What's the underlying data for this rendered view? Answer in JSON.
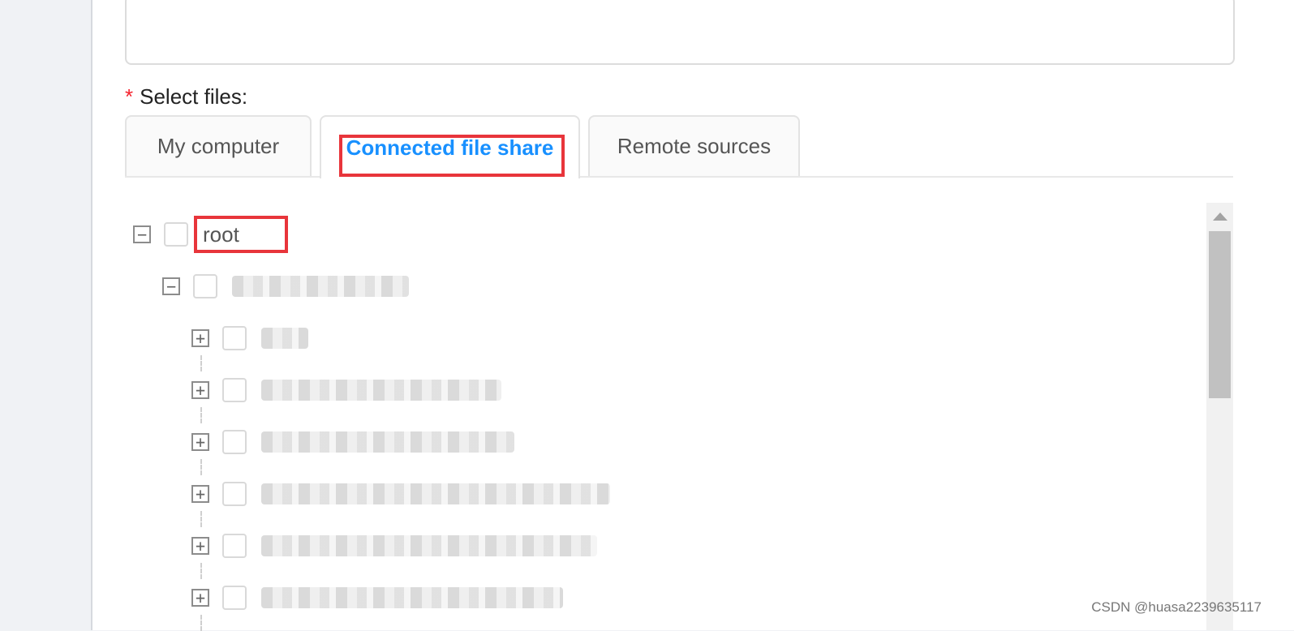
{
  "form": {
    "select_files_label": "Select files:",
    "required_marker": "*"
  },
  "tabs": [
    {
      "label": "My computer",
      "active": false
    },
    {
      "label": "Connected file share",
      "active": true
    },
    {
      "label": "Remote sources",
      "active": false
    }
  ],
  "tree": {
    "root": {
      "label": "root",
      "expanded": true,
      "checked": false
    },
    "child": {
      "label": "",
      "expanded": true,
      "checked": false,
      "redacted": true
    },
    "items": [
      {
        "label": "",
        "expanded": false,
        "checked": false,
        "redacted": true
      },
      {
        "label": "",
        "expanded": false,
        "checked": false,
        "redacted": true
      },
      {
        "label": "",
        "expanded": false,
        "checked": false,
        "redacted": true
      },
      {
        "label": "",
        "expanded": false,
        "checked": false,
        "redacted": true
      },
      {
        "label": "",
        "expanded": false,
        "checked": false,
        "redacted": true
      },
      {
        "label": "",
        "expanded": false,
        "checked": false,
        "redacted": true
      }
    ],
    "expanded_glyph": "−",
    "collapsed_glyph": "+"
  },
  "watermark": "CSDN @huasa2239635117",
  "colors": {
    "active_tab": "#1890ff",
    "highlight_box": "#e8353b",
    "required": "#f5222d"
  }
}
